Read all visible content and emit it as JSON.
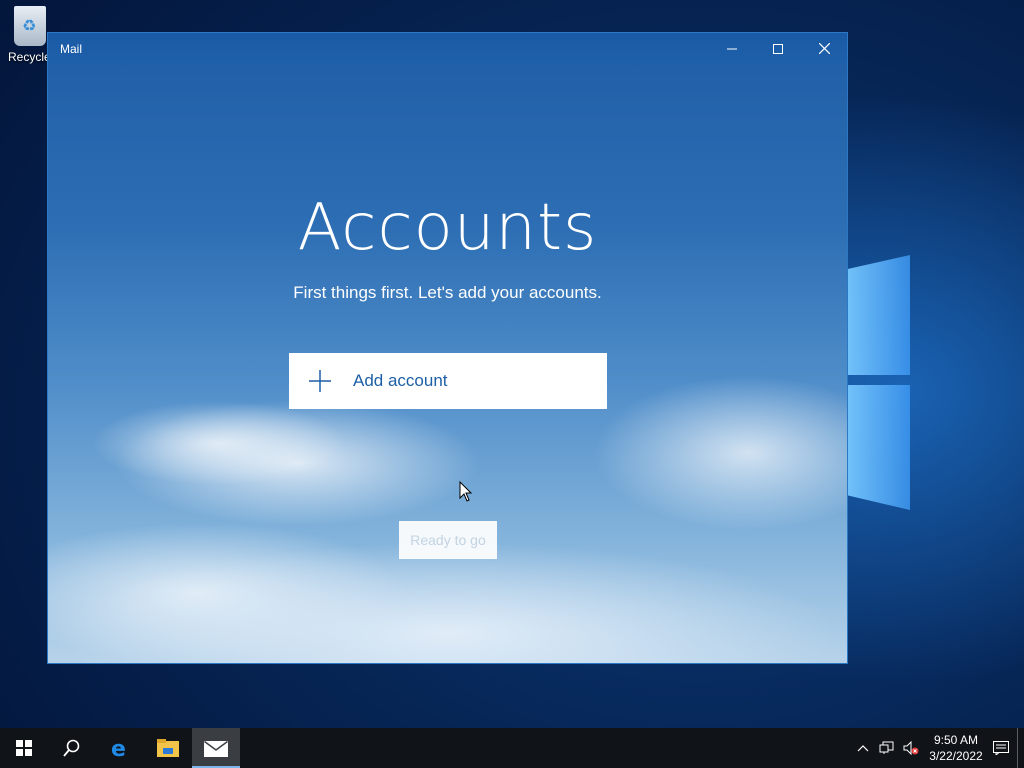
{
  "desktop": {
    "recycle_bin_label": "Recycle Bin"
  },
  "window": {
    "title": "Mail",
    "controls": {
      "minimize": "minimize",
      "maximize": "maximize",
      "close": "close"
    }
  },
  "main": {
    "heading": "Accounts",
    "subheading": "First things first. Let's add your accounts.",
    "add_account_label": "Add account",
    "ready_label": "Ready to go"
  },
  "taskbar": {
    "items": [
      "start-icon",
      "search-icon",
      "edge-icon",
      "file-explorer-icon",
      "mail-icon"
    ],
    "active_item": "mail-icon",
    "clock_time": "9:50 AM",
    "clock_date": "3/22/2022"
  },
  "colors": {
    "accent": "#1c5fa6",
    "titlebar": "#1f60ab",
    "taskbar": "#101318"
  }
}
